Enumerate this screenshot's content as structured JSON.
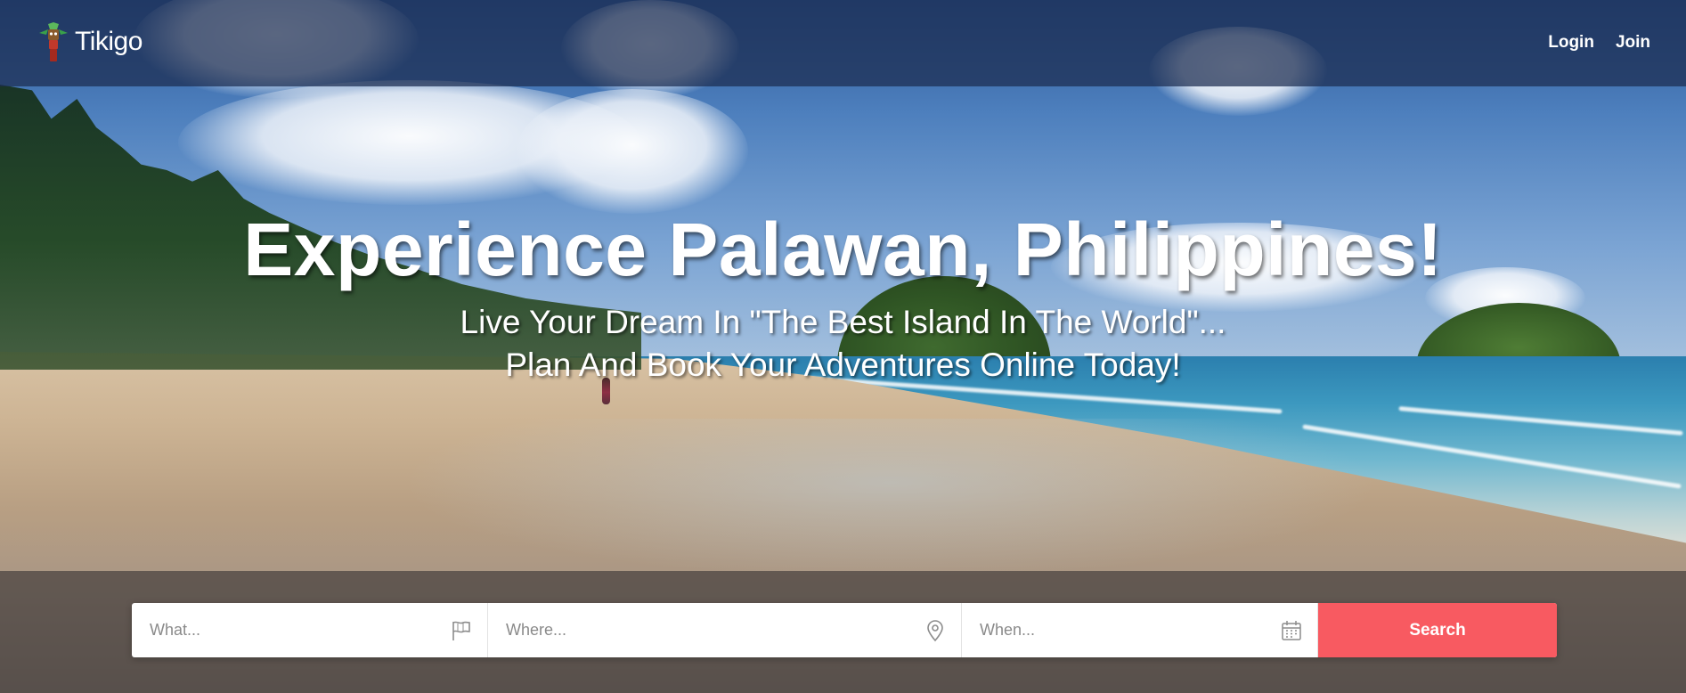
{
  "header": {
    "logo_text": "Tikigo",
    "nav": [
      {
        "label": "Login"
      },
      {
        "label": "Join"
      }
    ]
  },
  "hero": {
    "title": "Experience Palawan, Philippines!",
    "subtitle_line1": "Live Your Dream In \"The Best Island In The World\"...",
    "subtitle_line2": "Plan And Book Your Adventures Online Today!"
  },
  "search": {
    "what_placeholder": "What...",
    "where_placeholder": "Where...",
    "when_placeholder": "When...",
    "button_label": "Search",
    "button_color": "#f85a61",
    "icons": {
      "what": "flag-icon",
      "where": "map-pin-icon",
      "when": "calendar-icon"
    }
  }
}
